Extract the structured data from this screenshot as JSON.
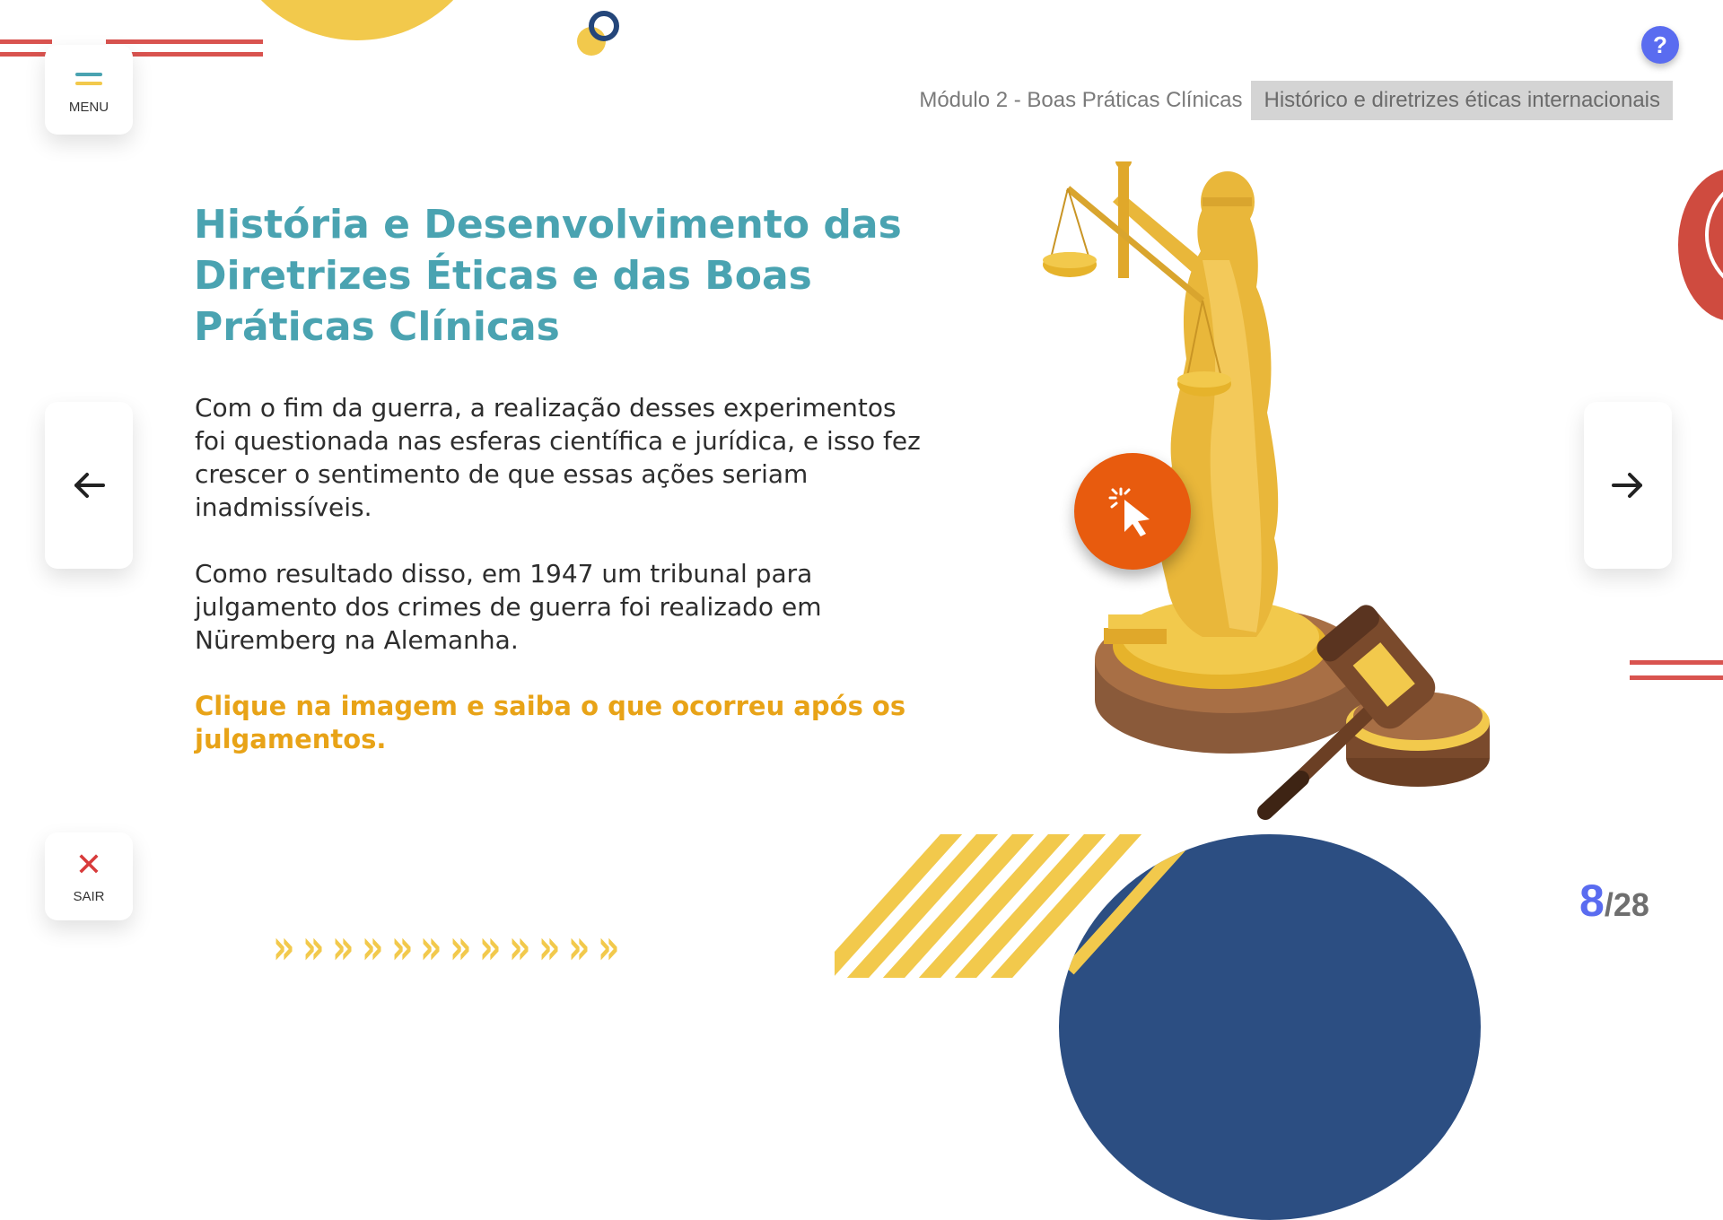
{
  "header": {
    "menu_label": "MENU",
    "help_label": "?",
    "module": "Módulo 2 - Boas Práticas Clínicas",
    "topic": "Histórico e diretrizes éticas internacionais"
  },
  "content": {
    "title": "História e Desenvolvimento das Diretrizes Éticas e das Boas Práticas Clínicas",
    "paragraph1": "Com o fim da guerra, a realização desses experimentos foi questionada nas esferas científica e jurídica, e isso fez crescer o sentimento de que essas ações seriam inadmissíveis.",
    "paragraph2": "Como resultado disso, em 1947 um tribunal para julgamento dos crimes de guerra foi realizado em Nüremberg na Alemanha.",
    "cta": "Clique na imagem e saiba o que ocorreu após os julgamentos."
  },
  "footer": {
    "exit_label": "SAIR",
    "page_current": "8",
    "page_separator": "/",
    "page_total": "28"
  },
  "icons": {
    "menu": "hamburger-icon",
    "exit": "close-icon",
    "prev": "arrow-left-icon",
    "next": "arrow-right-icon",
    "hotspot": "cursor-click-icon",
    "illustration": "lady-justice-gavel-illustration"
  },
  "colors": {
    "title": "#4aa3b1",
    "cta": "#e8a317",
    "accent_blue": "#5a6cf0",
    "hotspot": "#e85b0e",
    "exit": "#d83b3b",
    "deco_yellow": "#f2c94c",
    "deco_red": "#d9534f",
    "deco_navy": "#2c4e82"
  }
}
